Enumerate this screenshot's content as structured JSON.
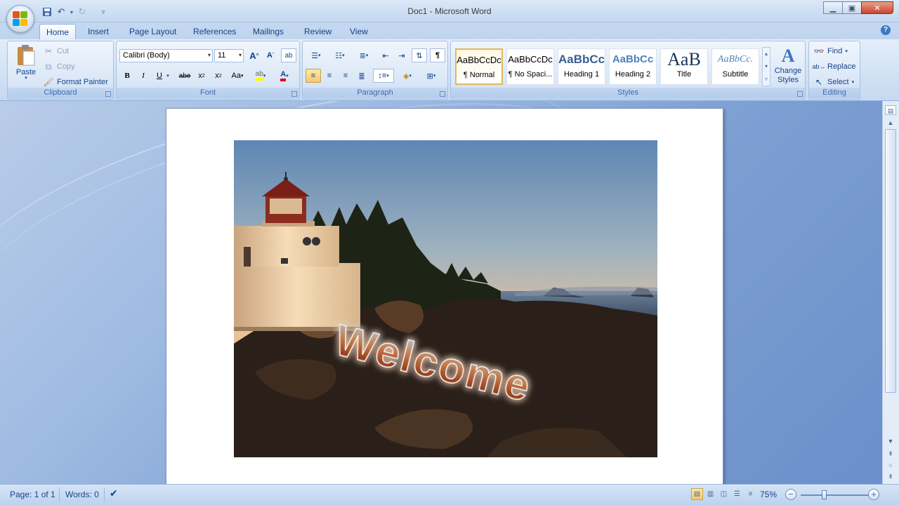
{
  "window": {
    "title": "Doc1 - Microsoft Word"
  },
  "tabs": [
    "Home",
    "Insert",
    "Page Layout",
    "References",
    "Mailings",
    "Review",
    "View"
  ],
  "ribbon": {
    "clipboard": {
      "label": "Clipboard",
      "paste": "Paste",
      "cut": "Cut",
      "copy": "Copy",
      "format_painter": "Format Painter"
    },
    "font": {
      "label": "Font",
      "font_name": "Calibri (Body)",
      "font_size": "11"
    },
    "paragraph": {
      "label": "Paragraph"
    },
    "styles": {
      "label": "Styles",
      "items": [
        {
          "sample": "AaBbCcDc",
          "name": "¶ Normal"
        },
        {
          "sample": "AaBbCcDc",
          "name": "¶ No Spaci..."
        },
        {
          "sample": "AaBbCc",
          "name": "Heading 1"
        },
        {
          "sample": "AaBbCc",
          "name": "Heading 2"
        },
        {
          "sample": "AaB",
          "name": "Title"
        },
        {
          "sample": "AaBbCc.",
          "name": "Subtitle"
        }
      ],
      "change_styles": "Change Styles"
    },
    "editing": {
      "label": "Editing",
      "find": "Find",
      "replace": "Replace",
      "select": "Select"
    }
  },
  "document": {
    "wordart_text": "Welcome"
  },
  "status": {
    "page": "Page: 1 of 1",
    "words": "Words: 0",
    "zoom": "75%"
  }
}
